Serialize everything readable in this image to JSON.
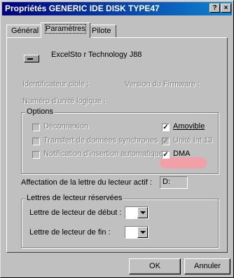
{
  "window": {
    "title": "Propriétés GENERIC IDE  DISK TYPE47",
    "help_btn": "?",
    "close_btn": "×"
  },
  "tabs": [
    {
      "label": "Général"
    },
    {
      "label": "Paramètres"
    },
    {
      "label": "Pilote"
    }
  ],
  "device": {
    "icon": "disk-drive-icon",
    "name": "ExcelSto r Technology J88"
  },
  "info": {
    "target_id": "Identificateur cible :",
    "firmware": "Version du Firmware :",
    "lun": "Numéro d'unité logique :"
  },
  "options": {
    "legend": "Options",
    "disconnect": {
      "label": "Déconnexion",
      "checked": false,
      "enabled": false
    },
    "sync": {
      "label": "Transfert de données synchrones",
      "checked": false,
      "enabled": false
    },
    "notify": {
      "label": "Notification d'insertion automatique",
      "checked": false,
      "enabled": false
    },
    "removable": {
      "label": "Amovible",
      "checked": true,
      "enabled": true
    },
    "int13": {
      "label": "Unité Int 13",
      "checked": true,
      "enabled": false
    },
    "dma": {
      "label": "DMA",
      "checked": true,
      "enabled": true
    }
  },
  "drive_letter": {
    "label": "Affectation de la lettre du lecteur actif :",
    "value": "D:"
  },
  "reserved": {
    "legend": "Lettres de lecteur réservées",
    "start_label": "Lettre de lecteur de début :",
    "end_label": "Lettre de lecteur de fin :"
  },
  "buttons": {
    "ok": "OK",
    "cancel": "Annuler"
  },
  "colors": {
    "titlebar_start": "#000080",
    "titlebar_end": "#1084d0",
    "highlight": "#f2a0a8"
  }
}
